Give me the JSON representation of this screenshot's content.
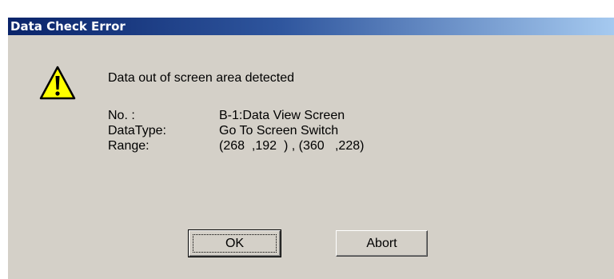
{
  "dialog": {
    "title": "Data Check Error",
    "icon": "warning-icon",
    "message": "Data out of screen area detected",
    "details": [
      {
        "label": "No. :",
        "value": "B-1:Data View Screen"
      },
      {
        "label": "DataType:",
        "value": "Go To Screen Switch"
      },
      {
        "label": "Range:",
        "value": "(268  ,192  ) , (360   ,228)"
      }
    ],
    "buttons": {
      "ok_label": "OK",
      "abort_label": "Abort"
    }
  },
  "colors": {
    "title_start": "#0a246a",
    "title_end": "#a6caf0",
    "dialog_bg": "#d4d0c8",
    "warning_fill": "#ffff00"
  }
}
